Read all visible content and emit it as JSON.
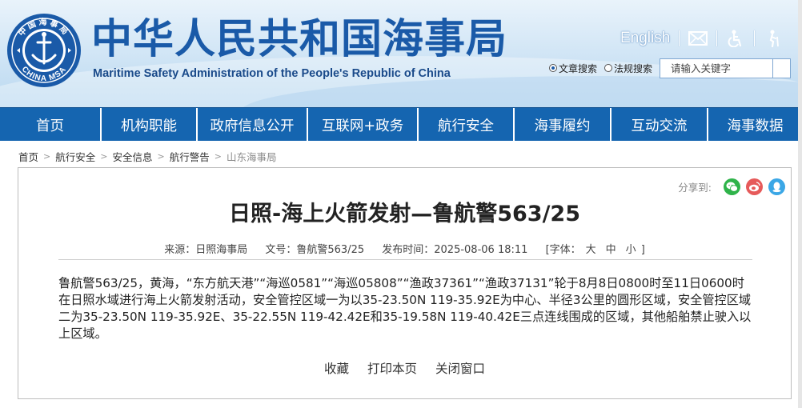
{
  "header": {
    "site_title": "中华人民共和国海事局",
    "site_subtitle": "Maritime Safety Administration of the People's Republic of China",
    "logo_top_text": "中国海事局",
    "logo_bottom_text": "CHINA MSA",
    "english_link": "English",
    "icons": [
      "mail-icon",
      "accessibility-icon",
      "elderly-mode-icon"
    ],
    "search": {
      "radio_article": "文章搜索",
      "radio_law": "法规搜索",
      "selected": "文章搜索",
      "placeholder": "请输入关键字"
    }
  },
  "nav": {
    "items": [
      "首页",
      "机构职能",
      "政府信息公开",
      "互联网+政务",
      "航行安全",
      "海事履约",
      "互动交流",
      "海事数据"
    ]
  },
  "breadcrumb": [
    "首页",
    "航行安全",
    "安全信息",
    "航行警告",
    "山东海事局"
  ],
  "article": {
    "share_label": "分享到:",
    "share_icons": [
      "wechat-icon",
      "weibo-icon",
      "qq-icon"
    ],
    "title": "日照-海上火箭发射—鲁航警563/25",
    "source": "来源：日照海事局",
    "doc_no": "文号：鲁航警563/25",
    "publish_time": "发布时间：2025-08-06 18:11",
    "font_label": "[字体：",
    "font_large": "大",
    "font_medium": "中",
    "font_small": "小",
    "font_close": "]",
    "body": "鲁航警563/25，黄海，“东方航天港”“海巡0581”“海巡05808”“渔政37361”“渔政37131”轮于8月8日0800时至11日0600时在日照水域进行海上火箭发射活动，安全管控区域一为以35-23.50N 119-35.92E为中心、半径3公里的圆形区域，安全管控区域二为35-23.50N 119-35.92E、35-22.55N 119-42.42E和35-19.58N 119-40.42E三点连线围成的区域，其他船舶禁止驶入以上区域。",
    "actions": {
      "favorite": "收藏",
      "print": "打印本页",
      "close": "关闭窗口"
    }
  },
  "colors": {
    "nav_bg": "#1565b0",
    "title_blue": "#1a5aa8",
    "wechat": "#2fb34a",
    "weibo": "#e65a5a",
    "qq": "#3ba7e6"
  }
}
